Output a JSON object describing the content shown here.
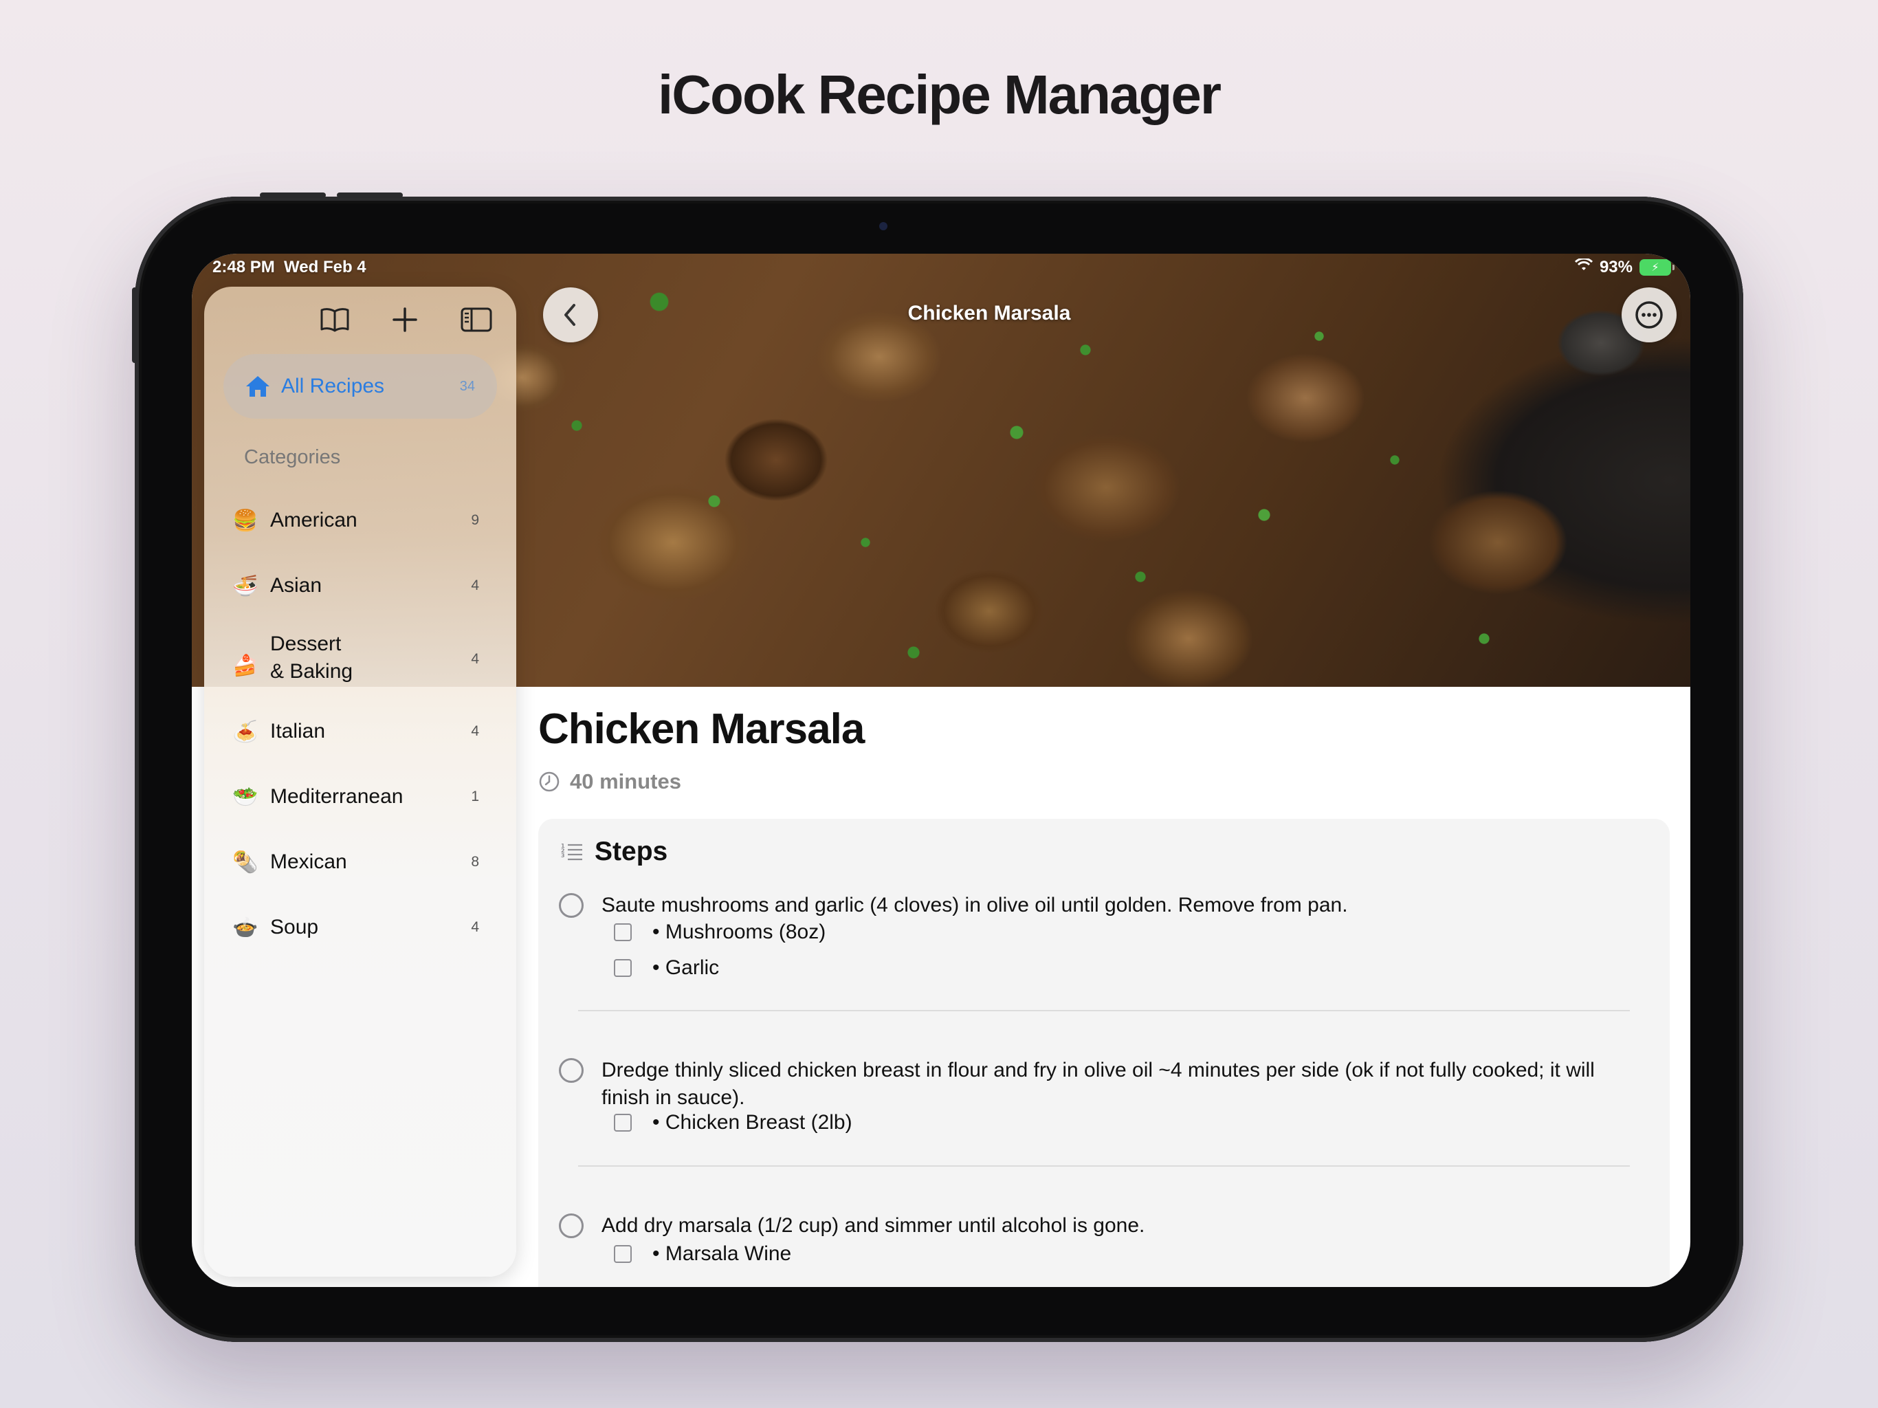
{
  "page": {
    "title": "iCook Recipe Manager"
  },
  "status_bar": {
    "time": "2:48 PM",
    "date": "Wed Feb 4",
    "battery": "93%"
  },
  "sidebar": {
    "all_recipes": {
      "label": "All Recipes",
      "count": "34"
    },
    "categories_header": "Categories",
    "categories": [
      {
        "emoji": "🍔",
        "name": "American",
        "count": "9"
      },
      {
        "emoji": "🍜",
        "name": "Asian",
        "count": "4"
      },
      {
        "emoji": "🍰",
        "name": "Dessert\n& Baking",
        "name_line1": "Dessert",
        "name_line2": "& Baking",
        "count": "4"
      },
      {
        "emoji": "🍝",
        "name": "Italian",
        "count": "4"
      },
      {
        "emoji": "🥗",
        "name": "Mediterranean",
        "count": "1"
      },
      {
        "emoji": "🌯",
        "name": "Mexican",
        "count": "8"
      },
      {
        "emoji": "🍲",
        "name": "Soup",
        "count": "4"
      }
    ]
  },
  "detail": {
    "nav_title": "Chicken Marsala",
    "title": "Chicken Marsala",
    "time": "40 minutes",
    "steps_header": "Steps",
    "steps": [
      {
        "text": "Saute mushrooms and garlic (4 cloves) in olive oil until golden. Remove from pan.",
        "ingredients": [
          "• Mushrooms (8oz)",
          "• Garlic"
        ]
      },
      {
        "text": "Dredge thinly sliced chicken breast in flour and fry in olive oil ~4 minutes per side (ok if not fully cooked; it will finish in sauce).",
        "ingredients": [
          "• Chicken Breast (2lb)"
        ]
      },
      {
        "text": "Add dry marsala (1/2 cup) and simmer until alcohol is gone.",
        "ingredients": [
          "• Marsala Wine"
        ]
      }
    ]
  },
  "colors": {
    "accent": "#2a7de1",
    "battery": "#4cd964"
  }
}
